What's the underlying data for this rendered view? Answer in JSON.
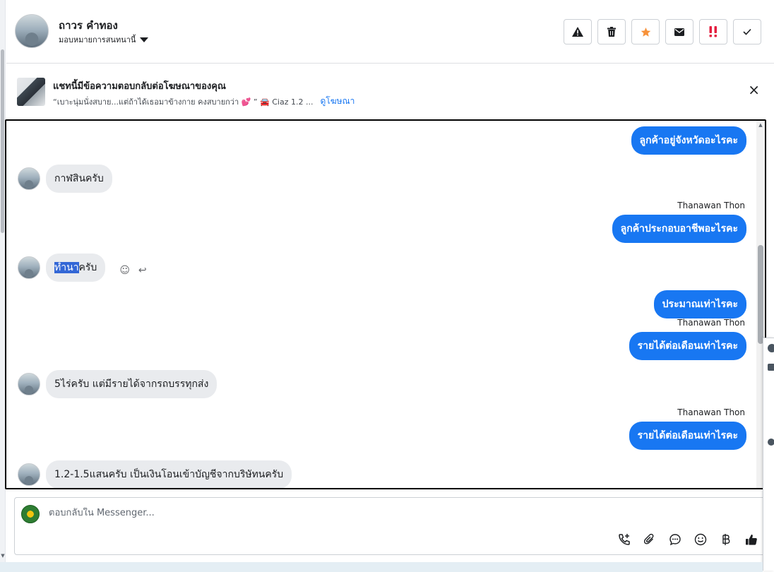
{
  "header": {
    "contact_name": "ถาวร คำทอง",
    "assign_label": "มอบหมายการสนทนานี้",
    "actions": [
      {
        "name": "report-spam-button",
        "icon": "warning-icon"
      },
      {
        "name": "delete-button",
        "icon": "trash-icon"
      },
      {
        "name": "star-button",
        "icon": "star-icon"
      },
      {
        "name": "mark-unread-button",
        "icon": "envelope-icon"
      },
      {
        "name": "follow-up-button",
        "icon": "double-exclamation-icon"
      },
      {
        "name": "mark-done-button",
        "icon": "check-icon"
      }
    ]
  },
  "ad_banner": {
    "title": "แชทนี้มีข้อความตอบกลับต่อโฆษณาของคุณ",
    "subtitle": "“เบาะนุ่มนั่งสบาย...แต่ถ้าได้เธอมาข้างกาย คงสบายกว่า 💕 ” 🚘 Ciaz 1.2 ...",
    "link": "ดูโฆษณา",
    "close": "×"
  },
  "messages": [
    {
      "dir": "out",
      "text": "ลูกค้าอยู่จังหวัดอะไรคะ"
    },
    {
      "dir": "in",
      "text": "กาฬสินครับ"
    },
    {
      "dir": "out",
      "sender": "Thanawan Thon",
      "text": "ลูกค้าประกอบอาชีพอะไรคะ"
    },
    {
      "dir": "in",
      "text_selected": "ทำนา",
      "text_rest": "ครับ"
    },
    {
      "dir": "out",
      "text": "ประมาณเท่าไรคะ"
    },
    {
      "dir": "out",
      "sender": "Thanawan Thon",
      "text": "รายได้ต่อเดือนเท่าไรคะ"
    },
    {
      "dir": "in",
      "text": "5ไร่ครับ แต่มีรายได้จากรถบรรทุกส่ง"
    },
    {
      "dir": "out",
      "sender": "Thanawan Thon",
      "text": "รายได้ต่อเดือนเท่าไรคะ"
    },
    {
      "dir": "in",
      "text": "1.2-1.5แสนครับ เป็นเงินโอนเข้าบัญชีจากบริษัทนครับ"
    }
  ],
  "composer": {
    "placeholder": "ตอบกลับใน Messenger..."
  },
  "colors": {
    "outgoing_bubble": "#1877f2",
    "incoming_bubble": "#e9ebee",
    "selection": "#3367d6",
    "star": "#f7923a",
    "urgent": "#e41e3f"
  }
}
